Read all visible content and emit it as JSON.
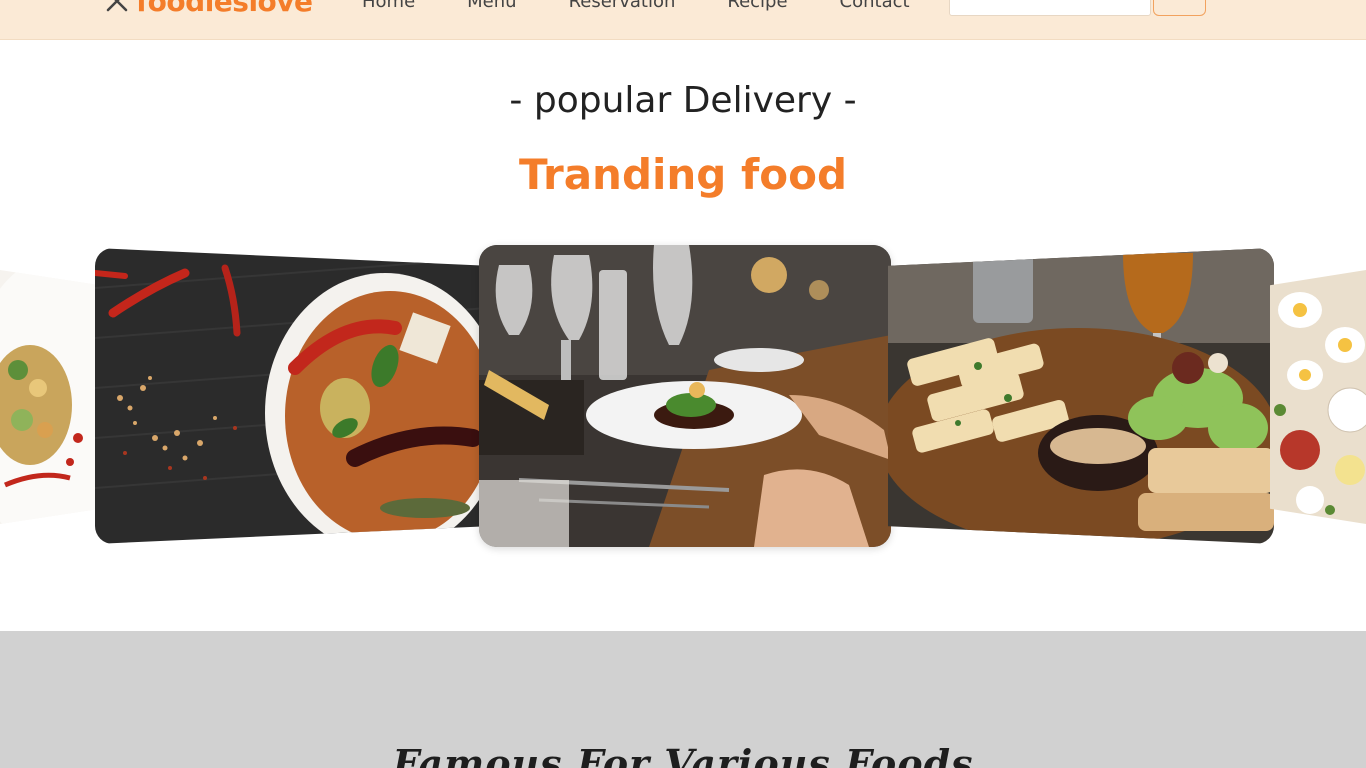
{
  "header": {
    "brand": "foodieslove",
    "nav": [
      "Home",
      "Menu",
      "Reservation",
      "Recipe",
      "Contact"
    ],
    "search_placeholder": ""
  },
  "section": {
    "subtitle": "- popular Delivery -",
    "title": "Tranding food"
  },
  "carousel": {
    "slides": [
      {
        "name": "salad-plate"
      },
      {
        "name": "curry-bowl"
      },
      {
        "name": "restaurant-table"
      },
      {
        "name": "bread-platter"
      },
      {
        "name": "breakfast-spread"
      }
    ],
    "active_index": 0,
    "dots_total": 6
  },
  "colors": {
    "accent": "#f47d2a",
    "header_bg": "#fbead6",
    "section_bg": "#d1d1d1"
  },
  "lower": {
    "title": "Famous For Various Foods"
  }
}
